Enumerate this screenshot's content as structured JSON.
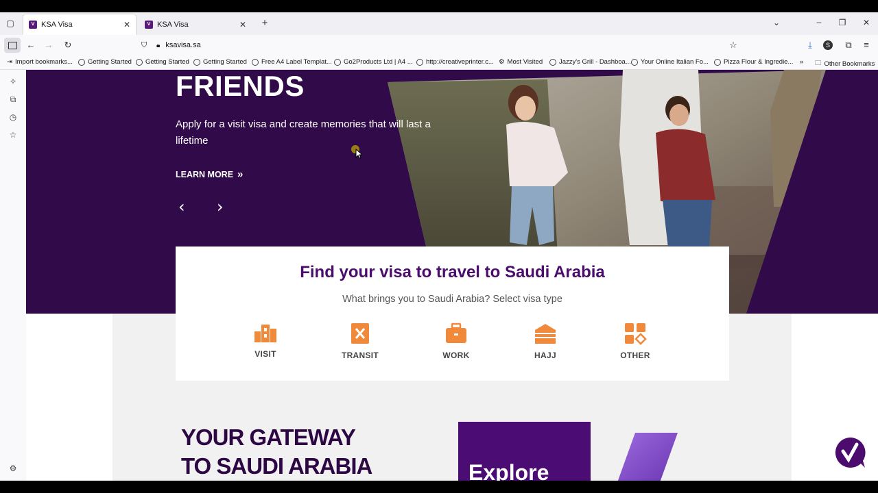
{
  "browser": {
    "tabs": [
      {
        "title": "KSA Visa",
        "favicon": "V",
        "active": true
      },
      {
        "title": "KSA Visa",
        "favicon": "V",
        "active": false
      }
    ],
    "url": "ksavisa.sa",
    "bookmarks": [
      "Import bookmarks...",
      "Getting Started",
      "Getting Started",
      "Getting Started",
      "Free A4 Label Templat...",
      "Go2Products Ltd | A4 ...",
      "http://creativeprinter.c...",
      "Most Visited",
      "Jazzy's Grill - Dashboa...",
      "Your Online Italian Fo...",
      "Pizza Flour & Ingredie..."
    ],
    "other_bookmarks": "Other Bookmarks",
    "profile_initial": "S"
  },
  "hero": {
    "heading": "FRIENDS",
    "subtitle": "Apply for a visit visa and create memories that will last a lifetime",
    "cta": "LEARN MORE"
  },
  "visa_finder": {
    "title": "Find your visa to travel to Saudi Arabia",
    "subtitle": "What brings you to Saudi Arabia? Select visa type",
    "types": [
      {
        "label": "VISIT",
        "icon": "visit-icon"
      },
      {
        "label": "TRANSIT",
        "icon": "transit-icon"
      },
      {
        "label": "WORK",
        "icon": "briefcase-icon"
      },
      {
        "label": "HAJJ",
        "icon": "kaaba-icon"
      },
      {
        "label": "OTHER",
        "icon": "other-shapes-icon"
      }
    ],
    "accent_color": "#f08a3a"
  },
  "gateway": {
    "line1": "YOUR GATEWAY",
    "line2": "TO SAUDI ARABIA"
  },
  "explore": {
    "label": "Explore"
  },
  "colors": {
    "brand_purple": "#300a49",
    "title_purple": "#4b0c6e",
    "accent_orange": "#f08a3a"
  }
}
